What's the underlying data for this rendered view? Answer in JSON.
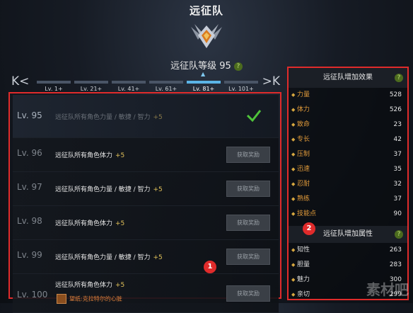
{
  "header": {
    "title": "远征队",
    "level_label": "远征队等级 95"
  },
  "tabs": {
    "items": [
      {
        "label": "Lv. 1+"
      },
      {
        "label": "Lv. 21+"
      },
      {
        "label": "Lv. 41+"
      },
      {
        "label": "Lv. 61+"
      },
      {
        "label": "Lv. 81+"
      },
      {
        "label": "Lv. 101+"
      }
    ],
    "active_index": 4,
    "prev": "K<",
    "next": ">K"
  },
  "rows": [
    {
      "level": "Lv. 95",
      "text": "远征队所有角色力量 / 敏捷 / 智力",
      "bonus": "+5",
      "status": "claimed"
    },
    {
      "level": "Lv. 96",
      "text": "远征队所有角色体力",
      "bonus": "+5",
      "button": "获取奖励"
    },
    {
      "level": "Lv. 97",
      "text": "远征队所有角色力量 / 敏捷 / 智力",
      "bonus": "+5",
      "button": "获取奖励"
    },
    {
      "level": "Lv. 98",
      "text": "远征队所有角色体力",
      "bonus": "+5",
      "button": "获取奖励"
    },
    {
      "level": "Lv. 99",
      "text": "远征队所有角色力量 / 敏捷 / 智力",
      "bonus": "+5",
      "button": "获取奖励"
    },
    {
      "level": "Lv. 100",
      "text": "远征队所有角色体力",
      "bonus": "+5",
      "button": "获取奖励",
      "reward": "望纸:克拉特尔的心脏"
    }
  ],
  "markers": {
    "one": "1",
    "two": "2"
  },
  "stats_panel": {
    "effects_title": "远征队增加效果",
    "effects": [
      {
        "name": "力量",
        "value": "528"
      },
      {
        "name": "体力",
        "value": "526"
      },
      {
        "name": "致命",
        "value": "23"
      },
      {
        "name": "专长",
        "value": "42"
      },
      {
        "name": "压制",
        "value": "37"
      },
      {
        "name": "迅速",
        "value": "35"
      },
      {
        "name": "忍耐",
        "value": "32"
      },
      {
        "name": "熟练",
        "value": "37"
      },
      {
        "name": "技能点",
        "value": "90"
      }
    ],
    "attributes_title": "远征队增加属性",
    "attributes": [
      {
        "name": "知性",
        "value": "263"
      },
      {
        "name": "胆量",
        "value": "283"
      },
      {
        "name": "魅力",
        "value": "300"
      },
      {
        "name": "亲切",
        "value": "299"
      }
    ]
  },
  "help_glyph": "?",
  "watermark": "素材吧",
  "colors": {
    "highlight_border": "#e02b2b",
    "active_tab": "#5bb4e6",
    "bonus": "#e4c35a",
    "stat_name": "#e09a3a"
  }
}
